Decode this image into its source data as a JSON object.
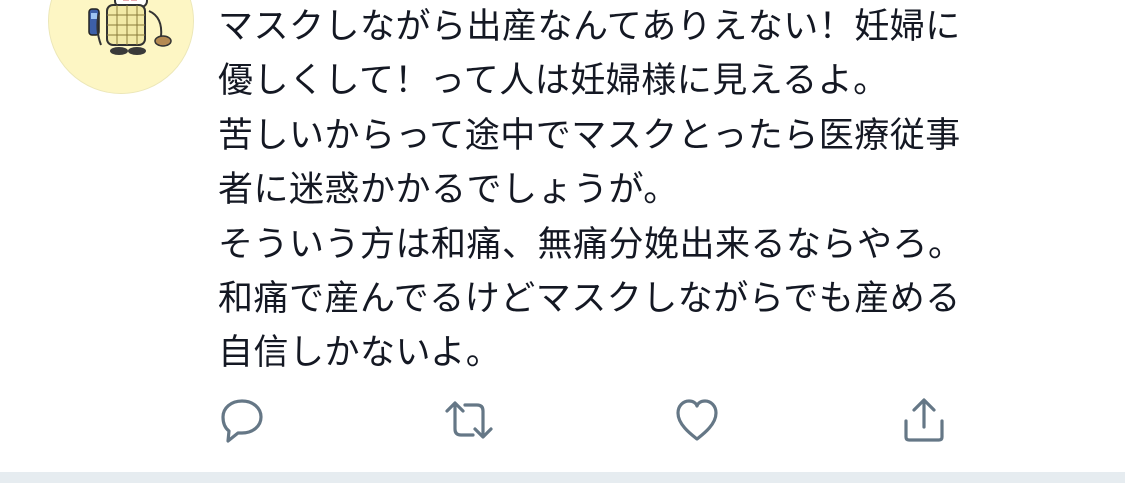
{
  "tweet": {
    "text_lines": [
      "マスクしながら出産なんてありえない！妊婦に",
      "優しくして！って人は妊婦様に見えるよ。",
      "苦しいからって途中でマスクとったら医療従事",
      "者に迷惑かかるでしょうが。",
      "そういう方は和痛、無痛分娩出来るならやろ。",
      "和痛で産んでるけどマスクしながらでも産める",
      "自信しかないよ。"
    ]
  },
  "actions": {
    "reply_icon": "reply-icon",
    "retweet_icon": "retweet-icon",
    "like_icon": "like-icon",
    "share_icon": "share-icon"
  },
  "colors": {
    "text": "#141823",
    "icon": "#657786",
    "footer": "#e6ecf0",
    "avatar_bg": "#fdf6c4"
  }
}
